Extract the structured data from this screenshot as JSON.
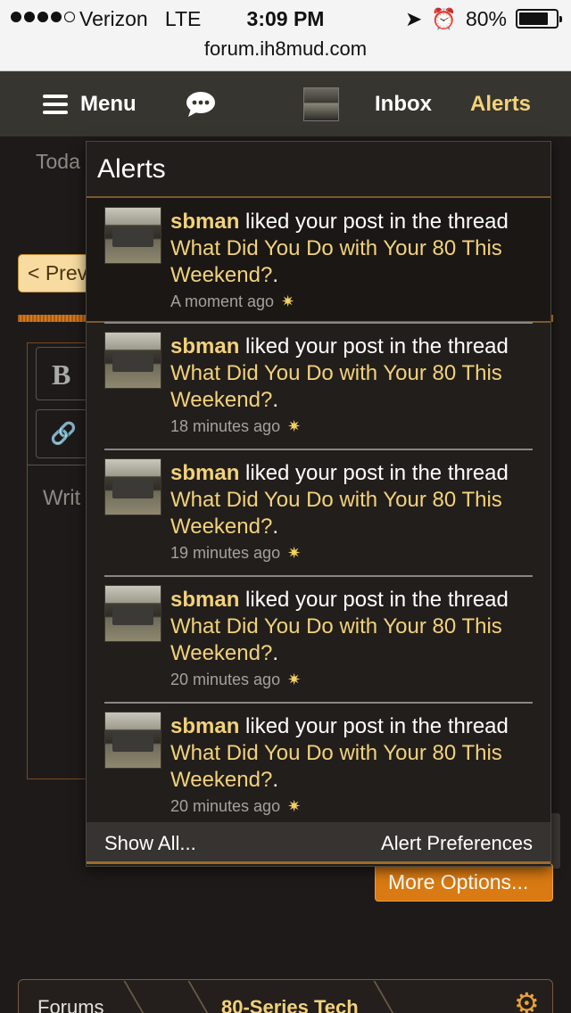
{
  "status_bar": {
    "carrier": "Verizon",
    "network": "LTE",
    "time": "3:09 PM",
    "battery": "80%",
    "battery_level": 0.8,
    "url": "forum.ih8mud.com"
  },
  "nav": {
    "menu_label": "Menu",
    "inbox_label": "Inbox",
    "alerts_label": "Alerts",
    "icons": [
      "hamburger-icon",
      "chat-bubble-icon",
      "avatar-thumbnail"
    ]
  },
  "background": {
    "today_text": "Toda",
    "prev_button": "< Prev",
    "bold_button": "B",
    "write_placeholder": "Writ",
    "more_options_button": "More Options...",
    "breadcrumb": [
      "Forums",
      "80-Series Tech"
    ]
  },
  "alerts": {
    "title": "Alerts",
    "action_text": "liked your post in the thread",
    "items": [
      {
        "user": "sbman",
        "thread": "What Did You Do with Your 80 This Weekend?",
        "time": "A moment ago"
      },
      {
        "user": "sbman",
        "thread": "What Did You Do with Your 80 This Weekend?",
        "time": "18 minutes ago"
      },
      {
        "user": "sbman",
        "thread": "What Did You Do with Your 80 This Weekend?",
        "time": "19 minutes ago"
      },
      {
        "user": "sbman",
        "thread": "What Did You Do with Your 80 This Weekend?",
        "time": "20 minutes ago"
      },
      {
        "user": "sbman",
        "thread": "What Did You Do with Your 80 This Weekend?",
        "time": "20 minutes ago"
      }
    ],
    "footer": {
      "show_all": "Show All...",
      "preferences": "Alert Preferences"
    }
  },
  "colors": {
    "accent": "#f2d27a",
    "page_bg": "#1e1a19",
    "nav_bg": "#37352f",
    "orange": "#d97a12"
  }
}
